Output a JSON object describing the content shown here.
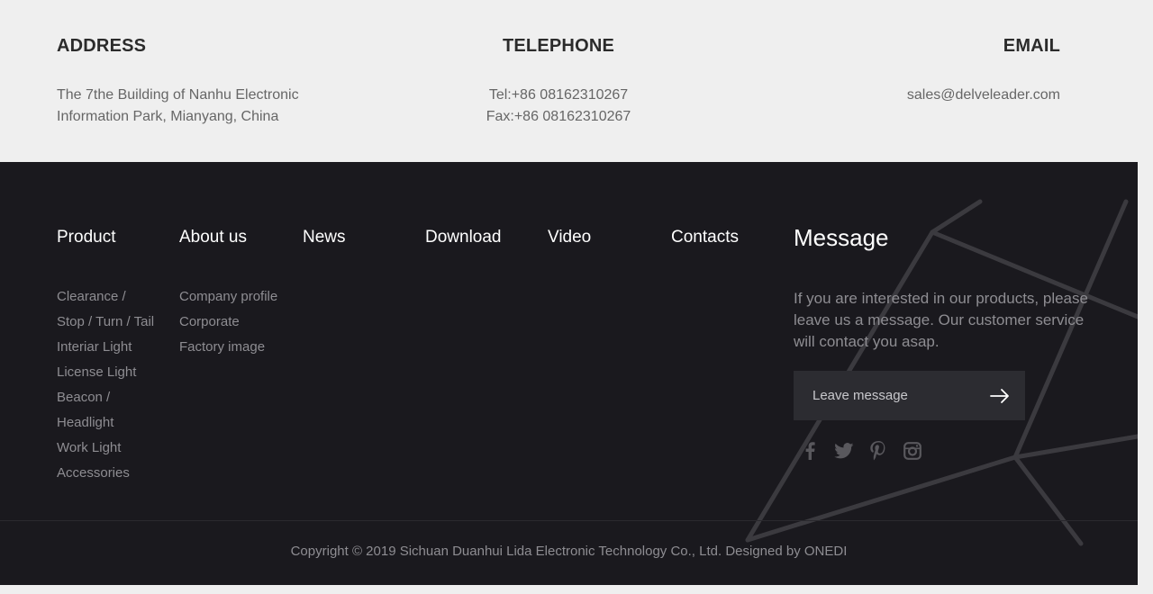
{
  "contact": {
    "address": {
      "title": "ADDRESS",
      "lines": [
        "The 7the Building of Nanhu Electronic",
        "Information Park, Mianyang, China"
      ]
    },
    "telephone": {
      "title": "TELEPHONE",
      "lines": [
        "Tel:+86 08162310267",
        "Fax:+86 08162310267"
      ]
    },
    "email": {
      "title": "EMAIL",
      "lines": [
        "sales@delveleader.com"
      ]
    }
  },
  "footer": {
    "nav": [
      {
        "label": "Product",
        "items": [
          "Clearance /",
          "Stop / Turn / Tail",
          "Interiar Light",
          "License Light",
          "Beacon /",
          "Headlight",
          "Work Light",
          "Accessories"
        ]
      },
      {
        "label": "About us",
        "items": [
          "Company profile",
          "Corporate",
          "Factory image"
        ]
      },
      {
        "label": "News",
        "items": []
      },
      {
        "label": "Download",
        "items": []
      },
      {
        "label": "Video",
        "items": []
      },
      {
        "label": "Contacts",
        "items": []
      }
    ],
    "message": {
      "title": "Message",
      "text": "If you are interested in our products, please leave us a message. Our customer service will contact you asap.",
      "button_label": "Leave message"
    },
    "social": [
      "facebook-icon",
      "twitter-icon",
      "pinterest-icon",
      "instagram-icon"
    ],
    "copyright": "Copyright © 2019 Sichuan Duanhui Lida Electronic Technology Co., Ltd. Designed by ONEDI"
  },
  "colors": {
    "footer_bg": "#1a191e",
    "band_bg": "#efefef",
    "heading": "#2b2b2b",
    "muted": "#8e8d92"
  }
}
